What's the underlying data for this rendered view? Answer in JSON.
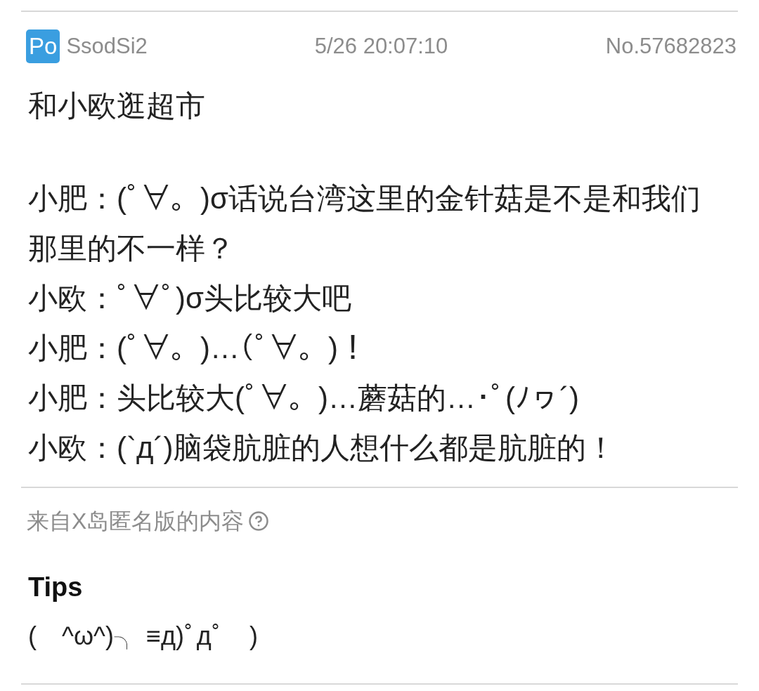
{
  "post": {
    "badge": "Po",
    "user_id": "SsodSi2",
    "time": "5/26 20:07:10",
    "number": "No.57682823",
    "paragraphs": [
      [
        "和小欧逛超市"
      ],
      [
        "小肥：(ﾟ∀。)σ话说台湾这里的金针菇是不是和我们那里的不一样？",
        "小欧：ﾟ∀ﾟ)σ头比较大吧",
        "小肥：(ﾟ∀。)…(ﾟ∀。)！",
        "小肥：头比较大(ﾟ∀。)…蘑菇的…･ﾟ(ﾉヮ´)",
        "小欧：(`д´)脑袋肮脏的人想什么都是肮脏的！"
      ]
    ]
  },
  "source_note": {
    "text": "来自X岛匿名版的内容"
  },
  "tips": {
    "heading": "Tips",
    "text": "(　^ω^)╮ ≡д)ﾟдﾟ　)"
  }
}
